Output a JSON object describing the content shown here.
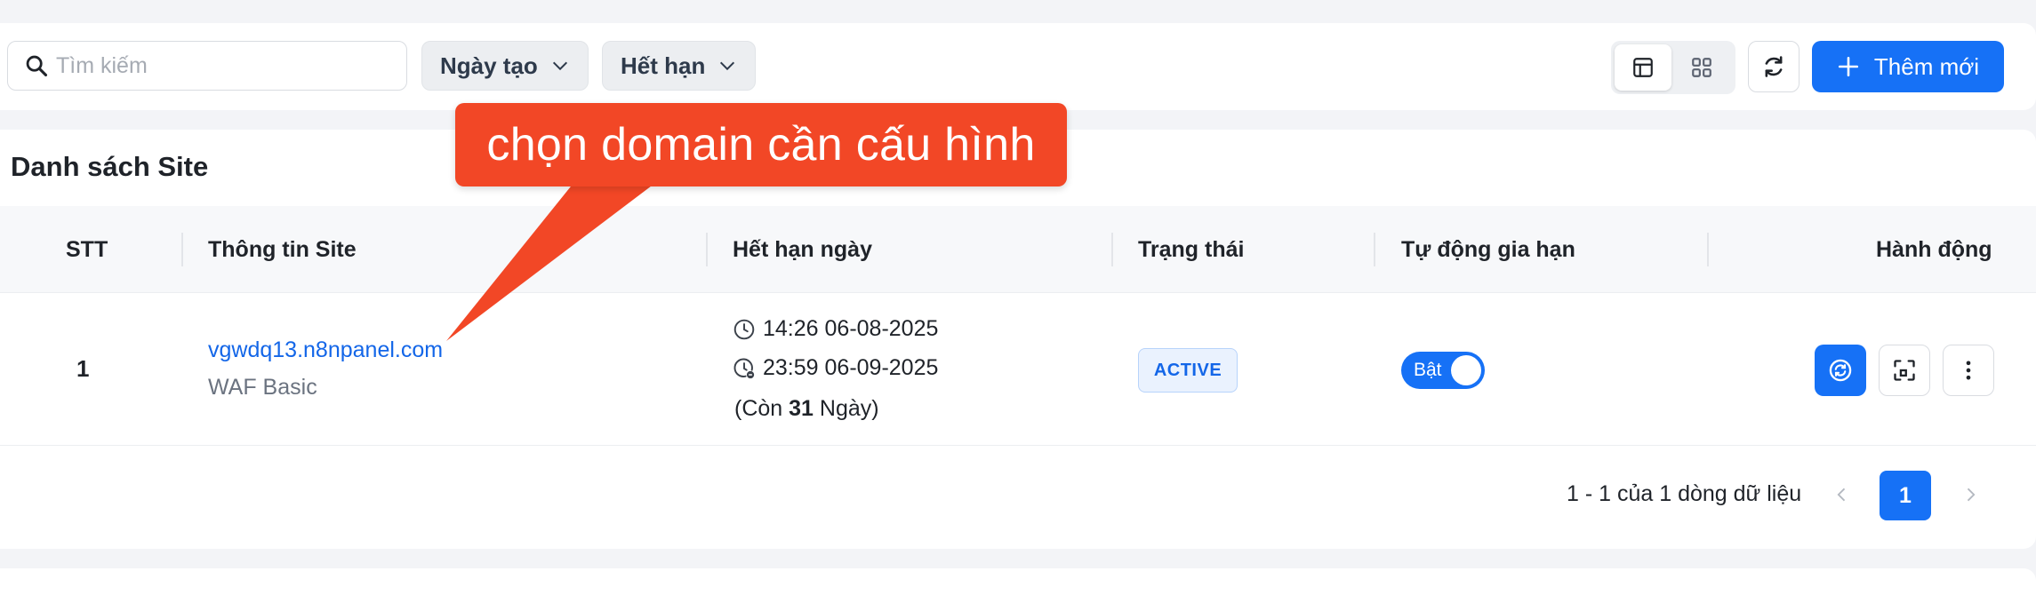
{
  "toolbar": {
    "search_placeholder": "Tìm kiếm",
    "filter_created": "Ngày tạo",
    "filter_expiry": "Hết hạn",
    "add_label": "Thêm mới"
  },
  "list": {
    "title": "Danh sách Site",
    "columns": [
      "STT",
      "Thông tin Site",
      "Hết hạn ngày",
      "Trạng thái",
      "Tự động gia hạn",
      "Hành động"
    ],
    "rows": [
      {
        "stt": "1",
        "domain": "vgwdq13.n8npanel.com",
        "plan": "WAF Basic",
        "created": "14:26 06-08-2025",
        "expires": "23:59 06-09-2025",
        "remain_prefix": "(Còn ",
        "remain_days": "31",
        "remain_suffix": " Ngày)",
        "status": "ACTIVE",
        "auto_renew_label": "Bật",
        "auto_renew_on": true
      }
    ]
  },
  "pagination": {
    "summary": "1 - 1 của 1 dòng dữ liệu",
    "current_page": "1"
  },
  "annotation": {
    "text": "chọn domain cần cấu hình",
    "color": "#f24726"
  },
  "colors": {
    "primary": "#1671f6",
    "link": "#1366e8"
  }
}
